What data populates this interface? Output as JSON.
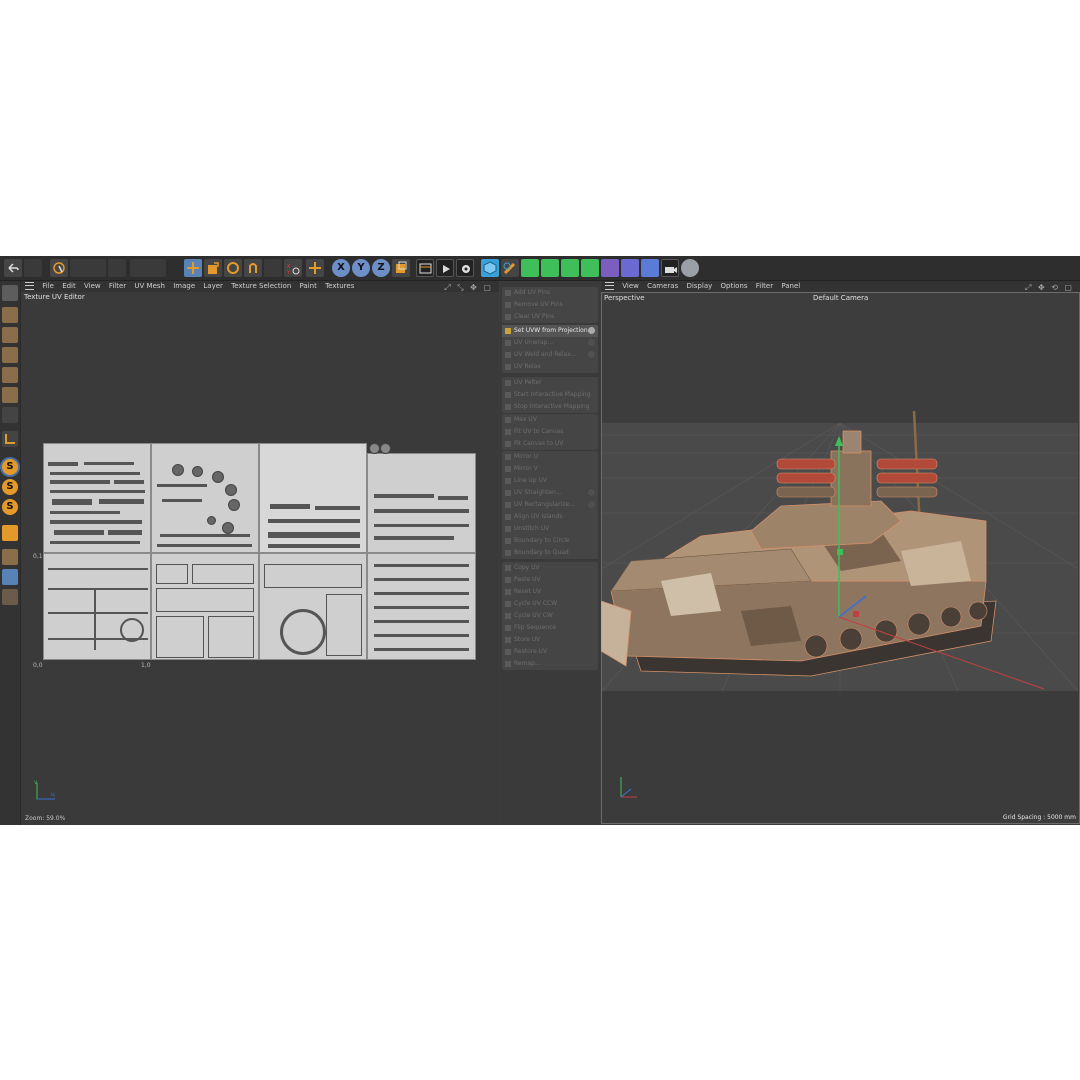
{
  "toolbar": {
    "icons": [
      "undo-icon",
      "redo-icon",
      "live-selection-icon",
      "model-mode-icon",
      "points-mode-icon",
      "move-icon",
      "scale-icon",
      "rotate-icon",
      "uv-points-icon",
      "uv-polygons-icon",
      "uv-mesh-icon",
      "transform-icon",
      "x-axis-icon",
      "y-axis-icon",
      "z-axis-icon",
      "coordinate-system-icon",
      "render-view-icon",
      "render-picture-viewer-icon",
      "render-settings-icon",
      "cube-icon",
      "pen-icon",
      "subdivision-icon",
      "extrude-icon",
      "cloner-icon",
      "array-icon",
      "deformer-icon",
      "field-icon",
      "floor-icon",
      "camera-icon",
      "light-icon"
    ],
    "axis_labels": [
      "X",
      "Y",
      "Z"
    ]
  },
  "uv_editor": {
    "menu": [
      "File",
      "Edit",
      "View",
      "Filter",
      "UV Mesh",
      "Image",
      "Layer",
      "Texture Selection",
      "Paint",
      "Textures"
    ],
    "title": "Texture UV Editor",
    "axis_labels": {
      "v1": "0,1",
      "origin": "0,0",
      "u1": "1,0"
    },
    "gizmo": {
      "v": "v",
      "u": "u"
    },
    "zoom": "Zoom: 59.0%"
  },
  "commands": {
    "groups": [
      [
        {
          "label": "Add UV Pins",
          "on": false
        },
        {
          "label": "Remove UV Pins",
          "on": false
        },
        {
          "label": "Clear UV Pins",
          "on": false
        }
      ],
      [
        {
          "label": "Set UVW from Projection...",
          "on": true
        },
        {
          "label": "UV Unwrap...",
          "on": false
        },
        {
          "label": "UV Weld and Relax...",
          "on": false
        },
        {
          "label": "UV Relax",
          "on": false
        }
      ],
      [
        {
          "label": "UV Pelter",
          "on": false
        },
        {
          "label": "Start Interactive Mapping",
          "on": false
        },
        {
          "label": "Stop Interactive Mapping",
          "on": false
        }
      ],
      [
        {
          "label": "Max UV",
          "on": false
        },
        {
          "label": "Fit UV to Canvas",
          "on": false
        },
        {
          "label": "Fit Canvas to UV",
          "on": false
        }
      ],
      [
        {
          "label": "Mirror U",
          "on": false
        },
        {
          "label": "Mirror V",
          "on": false
        },
        {
          "label": "Line Up UV",
          "on": false
        },
        {
          "label": "UV Straighten...",
          "on": false
        },
        {
          "label": "UV Rectangularize...",
          "on": false
        },
        {
          "label": "Align UV Islands",
          "on": false
        },
        {
          "label": "Unstitch UV",
          "on": false
        },
        {
          "label": "Boundary to Circle",
          "on": false
        },
        {
          "label": "Boundary to Quad",
          "on": false
        }
      ],
      [
        {
          "label": "Copy UV",
          "on": false
        },
        {
          "label": "Paste UV",
          "on": false
        },
        {
          "label": "Reset UV",
          "on": false
        },
        {
          "label": "Cycle UV CCW",
          "on": false
        },
        {
          "label": "Cycle UV CW",
          "on": false
        },
        {
          "label": "Flip Sequence",
          "on": false
        },
        {
          "label": "Store UV",
          "on": false
        },
        {
          "label": "Restore UV",
          "on": false
        },
        {
          "label": "Remap...",
          "on": false
        }
      ]
    ]
  },
  "viewport": {
    "menu": [
      "View",
      "Cameras",
      "Display",
      "Options",
      "Filter",
      "Panel"
    ],
    "view_name": "Perspective",
    "camera": "Default Camera",
    "grid_spacing": "Grid Spacing : 5000 mm",
    "colors": {
      "tank_hull": "#b09478",
      "tank_dark": "#6e5a46",
      "rocket_red": "#b24a3a",
      "axis_green": "#3fbf5a",
      "axis_red": "#c04040",
      "axis_blue": "#3a6fd8"
    }
  }
}
